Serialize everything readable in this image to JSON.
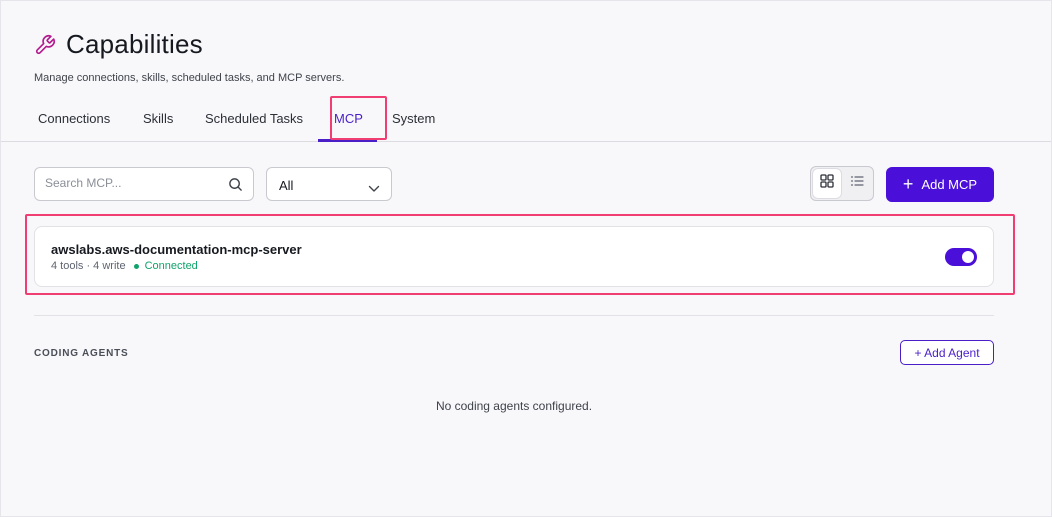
{
  "header": {
    "title": "Capabilities",
    "subtitle": "Manage connections, skills, scheduled tasks, and MCP servers.",
    "icon": "wrench-icon"
  },
  "tabs": [
    {
      "label": "Connections",
      "active": false
    },
    {
      "label": "Skills",
      "active": false
    },
    {
      "label": "Scheduled Tasks",
      "active": false
    },
    {
      "label": "MCP",
      "active": true
    },
    {
      "label": "System",
      "active": false
    }
  ],
  "toolbar": {
    "search_placeholder": "Search MCP...",
    "filter_value": "All",
    "add_label": "Add MCP",
    "view_mode": "grid"
  },
  "servers": [
    {
      "name": "awslabs.aws-documentation-mcp-server",
      "meta": "4 tools · 4 write",
      "status": "Connected",
      "enabled": true
    }
  ],
  "coding_agents": {
    "section_label": "CODING AGENTS",
    "add_label": "+ Add Agent",
    "empty_text": "No coding agents configured."
  },
  "colors": {
    "accent": "#4a0fd8",
    "status_connected": "#10a36b",
    "highlight": "#f03e72",
    "title_icon": "#b31a8f"
  }
}
